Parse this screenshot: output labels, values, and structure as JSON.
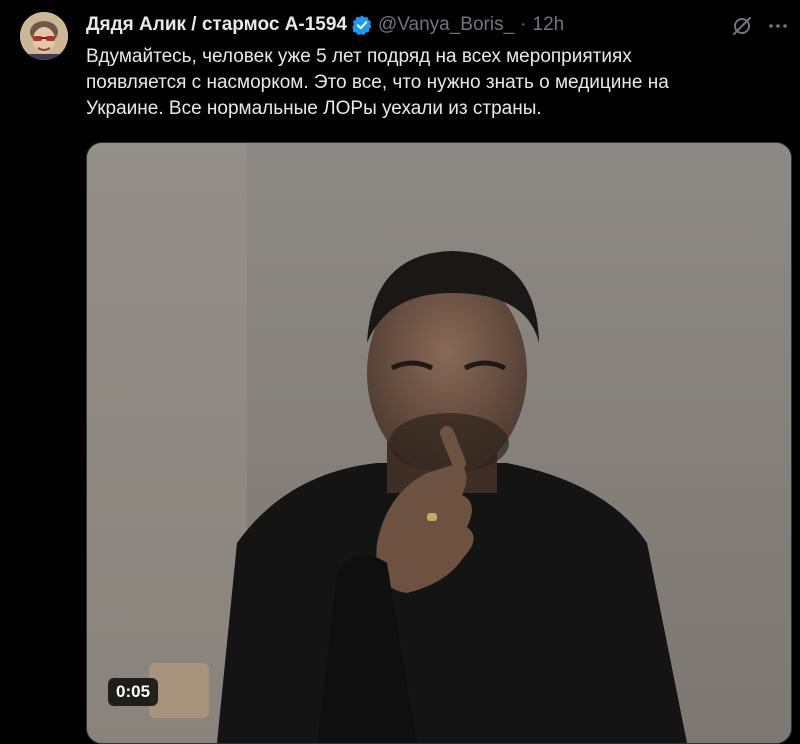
{
  "tweet": {
    "author_name": "Дядя Алик / стармос А-1594",
    "handle": "@Vanya_Boris_",
    "separator": "·",
    "time": "12h",
    "text_lines": [
      "Вдумайтесь, человек уже 5 лет подряд на всех мероприятиях",
      "появляется с насморком. Это все, что нужно знать о медицине на",
      "Украине. Все нормальные ЛОРы уехали из страны."
    ],
    "video": {
      "duration": "0:05"
    }
  },
  "icons": {
    "verified": "verified-badge-icon",
    "grok": "grok-icon",
    "more": "more-icon"
  },
  "colors": {
    "background": "#000000",
    "text": "#e7e9ea",
    "secondary_text": "#71767b",
    "verified": "#1d9bf0",
    "border": "#2f3336"
  }
}
